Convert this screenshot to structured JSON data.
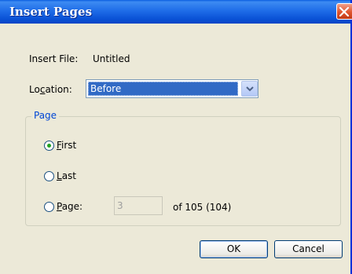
{
  "window": {
    "title": "Insert Pages"
  },
  "insert_file": {
    "label": "Insert File:",
    "value": "Untitled"
  },
  "location": {
    "label_pre": "Lo",
    "label_key": "c",
    "label_post": "ation:",
    "selected": "Before"
  },
  "page_group": {
    "legend": "Page",
    "options": [
      {
        "key": "F",
        "rest": "irst",
        "checked": true
      },
      {
        "key": "L",
        "rest": "ast",
        "checked": false
      },
      {
        "key": "P",
        "rest": "age:",
        "checked": false
      }
    ],
    "page_number_value": "3",
    "of_text": "of 105 (104)"
  },
  "buttons": {
    "ok": "OK",
    "cancel": "Cancel"
  },
  "icons": {
    "close": "close-icon",
    "dropdown": "chevron-down-icon"
  }
}
